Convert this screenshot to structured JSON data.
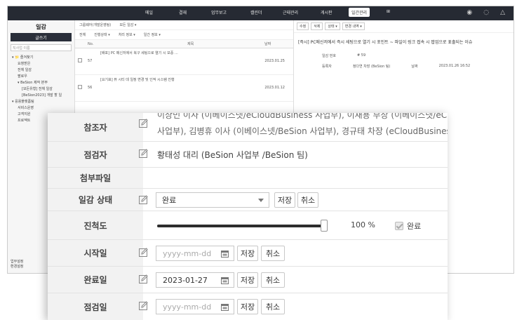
{
  "app": {
    "nav": [
      "메일",
      "결재",
      "업무보고",
      "캘린더",
      "근태관리",
      "게시판",
      "일간관리"
    ],
    "active_nav": "일간관리"
  },
  "sidebar": {
    "title": "일감",
    "write_label": "글쓰기",
    "search_placeholder": "직사업 이름",
    "items": [
      {
        "label": "▾ 📁 즐겨찾기",
        "level": 1
      },
      {
        "label": "요청받은",
        "level": 2
      },
      {
        "label": "전체 일감",
        "level": 2
      },
      {
        "label": "팔로우",
        "level": 2
      },
      {
        "label": "▾ BeSion 제작 본부",
        "level": 2
      },
      {
        "label": "[모든유형] 전체 일감",
        "level": 3
      },
      {
        "label": "[BeSion2023] 개발 할 일",
        "level": 3
      },
      {
        "label": "▾ 응용플랫폼팀",
        "level": 1
      },
      {
        "label": "서비스운영",
        "level": 2
      },
      {
        "label": "고객지원",
        "level": 2
      },
      {
        "label": "프로젝트",
        "level": 2
      }
    ],
    "bottom": [
      "업무설정",
      "환경설정"
    ]
  },
  "list": {
    "toolbar": [
      "그룹웨어(개발운영팀)",
      "모든 일감 ▾"
    ],
    "filters": [
      "전체",
      "진행상태 ▾",
      "처리 정보 ▾",
      "일간 정보 ▾"
    ],
    "columns": [
      "No.",
      "제목",
      "날짜"
    ],
    "rows": [
      {
        "no": "57",
        "title": "[배포] PC 메신저에서 복구 세팅으로 열기 시 보증 ...",
        "date": "2023.01.25"
      },
      {
        "no": "56",
        "title": "[요기표] 뷰 시티 데 일정 변경 및 인적 시스템 진행",
        "date": "2023.01.12"
      }
    ]
  },
  "detail": {
    "tools": [
      "수정",
      "삭제",
      "상태 ▾",
      "변경 내역 ▾"
    ],
    "title": "[즉시] PC메신저에서 즉시 세팅으로 열기 시 포인트 ~ 파일이 링크 접속 시 팝업으로 표출되는 이슈",
    "meta": [
      {
        "label": "일감 번호",
        "value": "# 59"
      },
      {
        "label": "등록자",
        "value": "정다연 차장 (BeSion 팀)"
      },
      {
        "label": "날짜",
        "value": "2023.01.26 16:52"
      }
    ]
  },
  "form": {
    "referrer": {
      "label": "참조자",
      "line1": "이상민 이사 (이베이스넷/eCloudBusiness 사업부), 이재용 부장 (이베이스넷/eCloudBusiness 사업부),",
      "line2": "사업부), 김병휴 이사 (이베이스넷/BeSion 사업부), 경규태 차장 (eCloudBusiness 사업부/응용솔루"
    },
    "inspector": {
      "label": "점검자",
      "value": "황태성 대리 (BeSion 사업부 /BeSion 팀)"
    },
    "attachment": {
      "label": "첨부파일"
    },
    "status": {
      "label": "일감 상태",
      "selected": "완료",
      "save_label": "저장",
      "cancel_label": "취소"
    },
    "progress": {
      "label": "진척도",
      "value": 100,
      "value_text": "100 %",
      "done_label": "완료"
    },
    "start_date": {
      "label": "시작일",
      "placeholder": "yyyy-mm-dd",
      "value": "",
      "save_label": "저장",
      "cancel_label": "취소"
    },
    "end_date": {
      "label": "완료일",
      "value": "2023-01-27",
      "save_label": "저장",
      "cancel_label": "취소"
    },
    "check_date": {
      "label": "점검일",
      "placeholder": "yyyy-mm-dd",
      "value": "",
      "save_label": "저장",
      "cancel_label": "취소"
    }
  }
}
